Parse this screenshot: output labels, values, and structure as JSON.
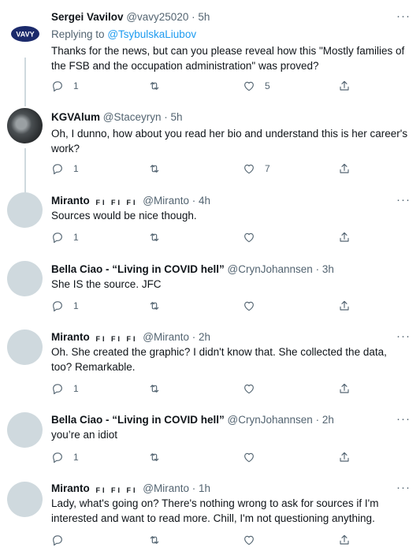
{
  "tweets": [
    {
      "name": "Sergei Vavilov",
      "flags": "",
      "handle": "@vavy25020",
      "separator": "·",
      "time": "5h",
      "replying_prefix": "Replying to",
      "replying_to": "@TsybulskaLiubov",
      "avatar": "vavy-logo",
      "avatar_text": "VAVY",
      "text": "Thanks for the news, but can you please reveal how this \"Mostly families of the FSB and the occupation administration\" was proved?",
      "reply_count": "1",
      "retweet_count": "",
      "like_count": "5"
    },
    {
      "name": "KGVAlum",
      "flags": "",
      "handle": "@Staceyryn",
      "separator": "·",
      "time": "5h",
      "avatar": "photo",
      "text": "Oh, I dunno, how about you read her bio and understand this is her career's work?",
      "reply_count": "1",
      "retweet_count": "",
      "like_count": "7"
    },
    {
      "name": "Miranto",
      "flags": "FI FI FI",
      "handle": "@Miranto",
      "separator": "·",
      "time": "4h",
      "avatar": "default",
      "text": "Sources would be nice though.",
      "reply_count": "1",
      "retweet_count": "",
      "like_count": ""
    },
    {
      "name": "Bella Ciao - “Living in COVID hell”",
      "flags": "",
      "handle": "@CrynJohannsen",
      "separator": "·",
      "time": "3h",
      "avatar": "default",
      "text": "She IS the source. JFC",
      "reply_count": "1",
      "retweet_count": "",
      "like_count": ""
    },
    {
      "name": "Miranto",
      "flags": "FI FI FI",
      "handle": "@Miranto",
      "separator": "·",
      "time": "2h",
      "avatar": "default",
      "text": "Oh. She created the graphic? I didn't know that. She collected the data, too? Remarkable.",
      "reply_count": "1",
      "retweet_count": "",
      "like_count": ""
    },
    {
      "name": "Bella Ciao - “Living in COVID hell”",
      "flags": "",
      "handle": "@CrynJohannsen",
      "separator": "·",
      "time": "2h",
      "avatar": "default",
      "text": "you’re an idiot",
      "reply_count": "1",
      "retweet_count": "",
      "like_count": ""
    },
    {
      "name": "Miranto",
      "flags": "FI FI FI",
      "handle": "@Miranto",
      "separator": "·",
      "time": "1h",
      "avatar": "default",
      "text": "Lady, what's going on? There's nothing wrong to ask for sources if I'm interested and want to read more. Chill, I'm not questioning anything.",
      "reply_count": "",
      "retweet_count": "",
      "like_count": ""
    }
  ],
  "more_icon": "ellipsis-icon",
  "colors": {
    "text": "#0f1419",
    "secondary": "#536471",
    "link": "#1d9bf0",
    "thread_line": "#cfd9de",
    "avatar_placeholder": "#cfd9de"
  }
}
